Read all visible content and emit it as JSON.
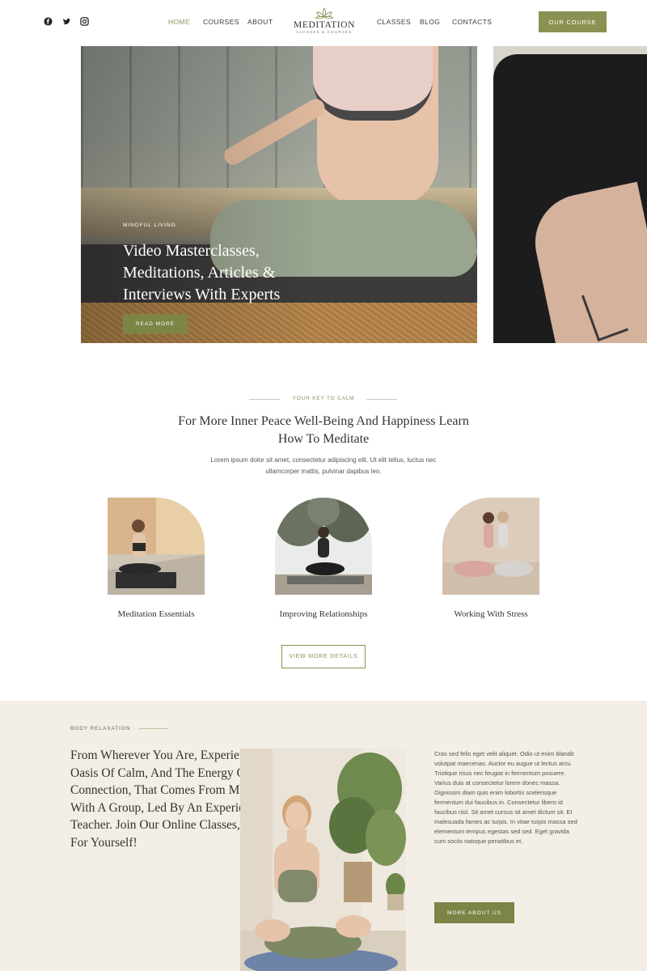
{
  "header": {
    "social": [
      {
        "icon": "facebook-icon"
      },
      {
        "icon": "twitter-icon"
      },
      {
        "icon": "instagram-icon"
      }
    ],
    "nav_left": [
      "HOME",
      "COURSES",
      "ABOUT"
    ],
    "nav_right": [
      "CLASSES",
      "BLOG",
      "CONTACTS"
    ],
    "logo": {
      "title": "MEDITATION",
      "subtitle": "CLASSES & COURSES"
    },
    "cta": "OUR COURSE",
    "accent_color": "#8b9152"
  },
  "hero": {
    "kicker": "MINDFUL LIVING",
    "title": "Video Masterclasses, Meditations, Articles & Interviews With Experts",
    "button": "READ MORE"
  },
  "key": {
    "kicker": "YOUR KEY TO CALM",
    "title": "For More Inner Peace Well-Being And Happiness Learn How To Meditate",
    "text": "Lorem ipsum dolor sit amet, consectetur adipiscing elit. Ut elit tellus, luctus nec ullamcorper mattis, pulvinar dapibus leo.",
    "cards": [
      {
        "caption": "Meditation Essentials"
      },
      {
        "caption": "Improving Relationships"
      },
      {
        "caption": "Working With Stress"
      }
    ],
    "button": "VIEW MORE DETAILS"
  },
  "relaxation": {
    "kicker": "BODY RELAXATION",
    "title": "From Wherever You Are, Experience The Oasis Of Calm, And The Energy Of Connection, That Comes From Meditating With A Group, Led By An Experienced Teacher. Join Our Online Classes, And See For Yourself!",
    "text": "Cras sed felis eget velit aliquet. Odio ut enim blandit volutpat maecenas. Auctor eu augue ut lectus arcu. Tristique risus nec feugiat in fermentum posuere. Varius duis at consectetur lorem donec massa. Dignissim diam quis enim lobortis scelerisque fermentum dui faucibus in. Consectetur libero id faucibus nisl. Sit amet cursus sit amet dictum sit. Et malesuada fames ac turpis. In vitae turpis massa sed elementum tempus egestas sed sed. Eget gravida cum sociis natoque penatibus et.",
    "button": "MORE ABOUT US",
    "background": "#f3efe6"
  }
}
